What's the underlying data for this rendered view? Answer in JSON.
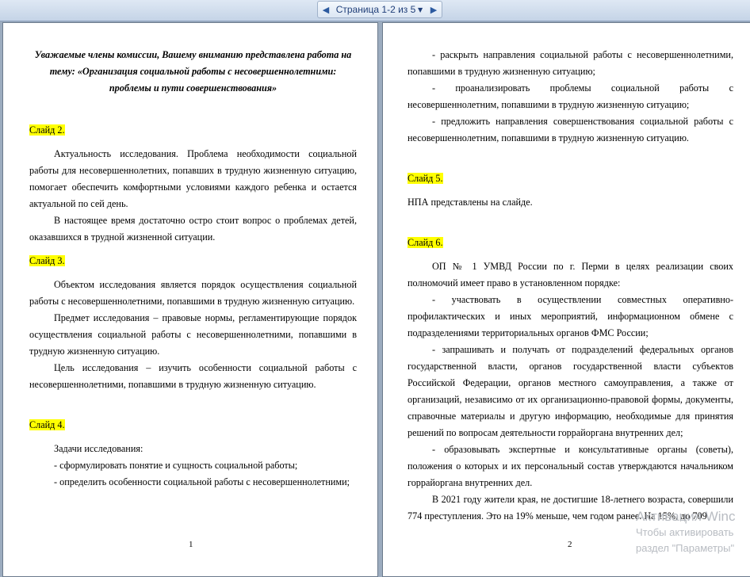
{
  "nav": {
    "label": "Страница 1-2 из 5"
  },
  "page1": {
    "title": [
      "Уважаемые члены комиссии, Вашему вниманию представлена работа на",
      "тему: «Организация социальной работы с несовершеннолетними:",
      "проблемы и пути совершенствования»"
    ],
    "slide2": "Слайд 2.",
    "slide2_p1": "Актуальность исследования. Проблема необходимости социальной работы для несовершеннолетних, попавших в трудную жизненную ситуацию, помогает обеспечить комфортными условиями каждого ребенка и остается актуальной по сей день.",
    "slide2_p2": "В настоящее время достаточно остро стоит вопрос о проблемах детей, оказавшихся в трудной жизненной ситуации.",
    "slide3": "Слайд 3.",
    "slide3_p1": "Объектом исследования является порядок осуществления социальной работы с несовершеннолетними, попавшими в трудную жизненную ситуацию.",
    "slide3_p2": "Предмет исследования – правовые нормы, регламентирующие порядок осуществления социальной работы с несовершеннолетними, попавшими в трудную жизненную ситуацию.",
    "slide3_p3": "Цель исследования – изучить особенности социальной работы с несовершеннолетними, попавшими в трудную жизненную ситуацию.",
    "slide4": "Слайд 4.",
    "slide4_p1": "Задачи исследования:",
    "slide4_p2": "- сформулировать понятие и сущность социальной работы;",
    "slide4_p3": "- определить особенности социальной работы с несовершеннолетними;",
    "page_number": "1"
  },
  "page2": {
    "p1": "- раскрыть направления социальной работы с несовершеннолетними, попавшими в трудную жизненную ситуацию;",
    "p2": "- проанализировать проблемы социальной работы с несовершеннолетним, попавшими в трудную жизненную ситуацию;",
    "p3": "- предложить направления совершенствования социальной работы с несовершеннолетним, попавшими в трудную жизненную ситуацию.",
    "slide5": "Слайд 5.",
    "slide5_p1": "НПА представлены на слайде.",
    "slide6": "Слайд 6.",
    "slide6_p1": "ОП № 1 УМВД России по г. Перми в целях реализации своих полномочий имеет право в установленном порядке:",
    "slide6_p2": "- участвовать в осуществлении совместных оперативно-профилактических и иных мероприятий, информационном обмене с подразделениями территориальных органов ФМС России;",
    "slide6_p3": "- запрашивать и получать от подразделений федеральных органов государственной власти, органов государственной власти субъектов Российской Федерации, органов местного самоуправления, а также от организаций, независимо от их организационно-правовой формы, документы, справочные материалы и другую информацию, необходимые для принятия решений по вопросам деятельности горрайоргана внутренних дел;",
    "slide6_p4": "- образовывать экспертные и консультативные органы (советы), положения о которых и их персональный состав утверждаются начальником горрайоргана внутренних дел.",
    "slide6_p5": "В 2021 году жители края, не достигшие 18-летнего возраста, совершили 774 преступления. Это на 19% меньше, чем годом ранее. На 15%, до 709",
    "page_number": "2"
  },
  "watermark": {
    "line1": "Активация Winc",
    "line2": "Чтобы активировать",
    "line3": "раздел \"Параметры\""
  }
}
